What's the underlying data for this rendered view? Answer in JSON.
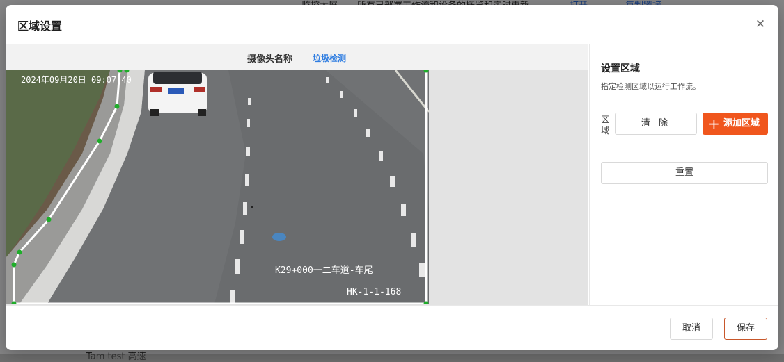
{
  "background": {
    "header_fragments": [
      "监控大屏",
      "所有已部署工作流和设备的概览和实时更新",
      "打开",
      "复制链接"
    ],
    "footer_fragment": "Tam test 高速"
  },
  "modal": {
    "title": "区域设置",
    "close_icon": "close-icon"
  },
  "camera": {
    "label": "摄像头名称",
    "name": "垃圾检测",
    "osd_timestamp": "2024年09月20日 09:07:40",
    "osd_location": "K29+000一二车道-车尾",
    "osd_id": "HK-1-1-168"
  },
  "region_panel": {
    "title": "设置区域",
    "description": "指定检测区域以运行工作流。",
    "region_label": "区域",
    "clear_label": "清 除",
    "add_label": "添加区域",
    "add_icon": "plus-icon",
    "reset_label": "重置"
  },
  "footer": {
    "cancel_label": "取消",
    "save_label": "保存"
  },
  "colors": {
    "accent": "#f0561d",
    "link": "#2f7de1",
    "polygon_stroke": "#ffffff",
    "polygon_points": "#1fae2a"
  }
}
